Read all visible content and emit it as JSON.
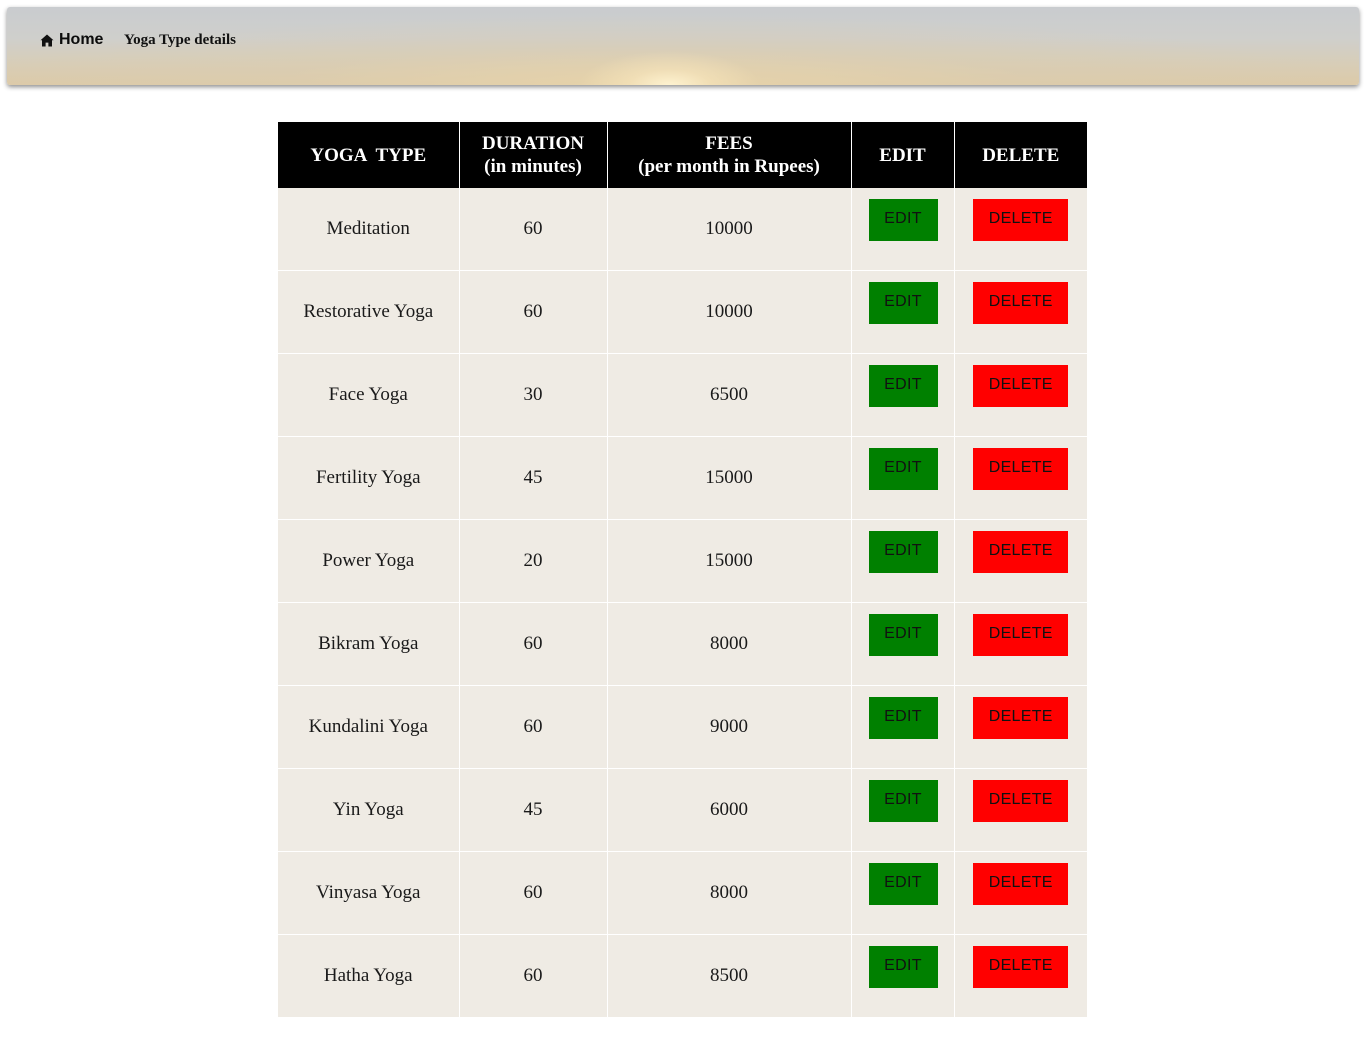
{
  "nav": {
    "home_icon": "home-icon",
    "home_label": "Home",
    "page_label": "Yoga Type details"
  },
  "table": {
    "headers": {
      "type": "YOGA  TYPE",
      "duration_line1": "DURATION",
      "duration_line2": "(in minutes)",
      "fees_line1": "FEES",
      "fees_line2": "(per month in Rupees)",
      "edit": "EDIT",
      "delete": "DELETE"
    },
    "edit_label": "EDIT",
    "delete_label": "DELETE",
    "colors": {
      "header_bg": "#000000",
      "row_bg": "#efebe4",
      "edit_bg": "#008000",
      "delete_bg": "#ff0000"
    },
    "rows": [
      {
        "type": "Meditation",
        "duration": "60",
        "fees": "10000"
      },
      {
        "type": "Restorative Yoga",
        "duration": "60",
        "fees": "10000"
      },
      {
        "type": "Face Yoga",
        "duration": "30",
        "fees": "6500"
      },
      {
        "type": "Fertility Yoga",
        "duration": "45",
        "fees": "15000"
      },
      {
        "type": "Power Yoga",
        "duration": "20",
        "fees": "15000"
      },
      {
        "type": "Bikram Yoga",
        "duration": "60",
        "fees": "8000"
      },
      {
        "type": "Kundalini Yoga",
        "duration": "60",
        "fees": "9000"
      },
      {
        "type": "Yin Yoga",
        "duration": "45",
        "fees": "6000"
      },
      {
        "type": "Vinyasa Yoga",
        "duration": "60",
        "fees": "8000"
      },
      {
        "type": "Hatha Yoga",
        "duration": "60",
        "fees": "8500"
      }
    ]
  }
}
